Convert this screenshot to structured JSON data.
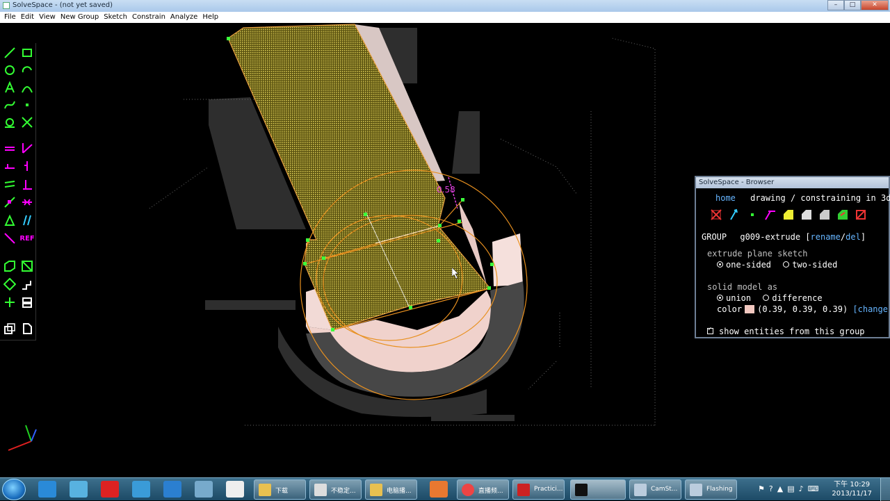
{
  "window": {
    "title": "SolveSpace - (not yet saved)",
    "buttons": [
      "–",
      "□",
      "✕"
    ]
  },
  "menu": [
    "File",
    "Edit",
    "View",
    "New Group",
    "Sketch",
    "Constrain",
    "Analyze",
    "Help"
  ],
  "toolbar": {
    "tools": [
      "line-tool",
      "rectangle-tool",
      "circle-tool",
      "arc-tool",
      "text-tool",
      "tangent-arc-tool",
      "bezier-tool",
      "point-tool",
      "construction-tool",
      "split-tool",
      "distance-constraint-tool",
      "angle-constraint-tool",
      "horizontal-constraint-tool",
      "vertical-constraint-tool",
      "parallel-constraint-tool",
      "perpendicular-constraint-tool",
      "on-point-constraint-tool",
      "symmetric-constraint-tool",
      "equal-constraint-tool",
      "other-supplementary-tool",
      "reference-tool",
      "workplane-group-tool",
      "extrude-group-tool",
      "lathe-group-tool",
      "step-translate-tool",
      "step-rotate-tool",
      "import-group-tool",
      "new-sheet-tool"
    ],
    "ref_label": "REF"
  },
  "canvas": {
    "dimension_label": "0.58"
  },
  "browser": {
    "title": "SolveSpace - Browser",
    "nav_home": "home",
    "nav_title": "drawing / constraining in 3d",
    "group_label": "GROUP",
    "group_name": "g009-extrude",
    "rename": "rename",
    "slash": "/",
    "del": "del",
    "extrude_heading": "extrude plane sketch",
    "one_sided": "one-sided",
    "two_sided": "two-sided",
    "solid_heading": "solid model as",
    "union": "union",
    "difference": "difference",
    "color_label": "color",
    "color_value": "(0.39, 0.39, 0.39)",
    "change": "[change",
    "show_entities": "show entities from this group",
    "colors": {
      "accent": "#66b5ff",
      "swatch": "#f2c8c0"
    }
  },
  "taskbar": {
    "buttons": [
      "下载",
      "不稳定...",
      "电脑播...",
      "",
      "",
      "直播频...",
      "Practici...",
      "",
      "CamSt...",
      "Flashing"
    ],
    "time": "下午 10:29",
    "date": "2013/11/17"
  }
}
